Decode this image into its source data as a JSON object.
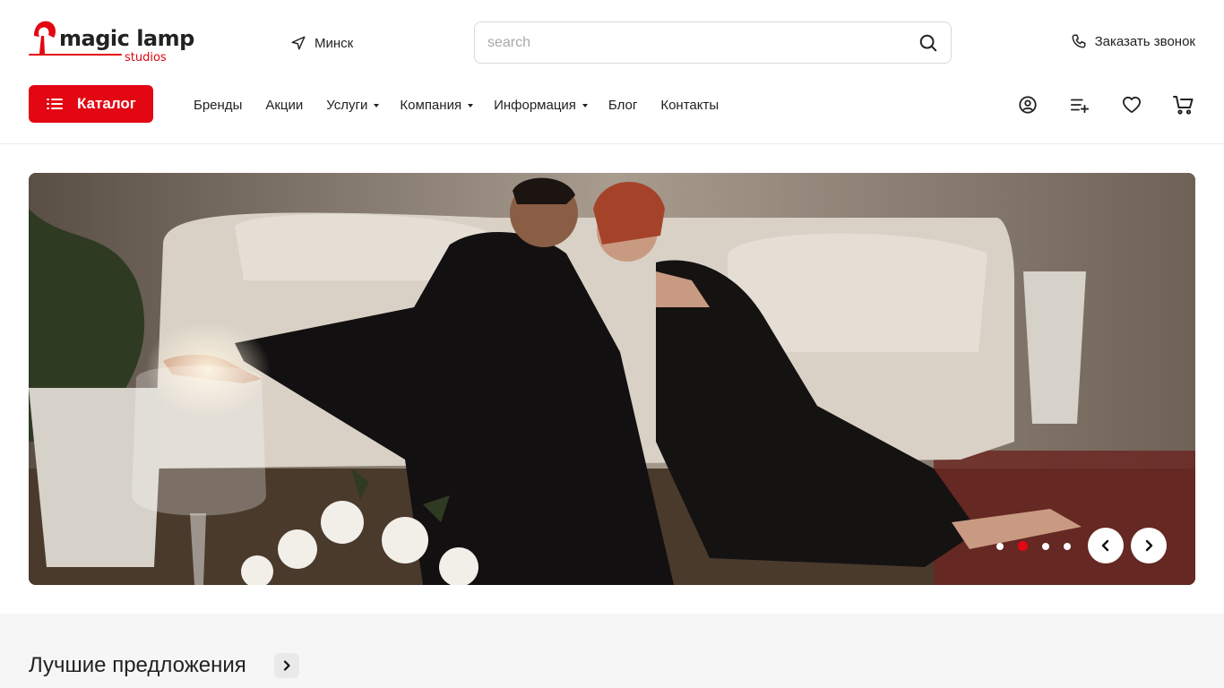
{
  "brand": {
    "name": "magic lamp",
    "sub": "studios",
    "color": "#e30613"
  },
  "header": {
    "city": "Минск",
    "city_icon": "location-arrow-icon",
    "search_placeholder": "search",
    "search_value": "",
    "callback_label": "Заказать звонок",
    "callback_icon": "phone-icon"
  },
  "catalog": {
    "label": "Каталог",
    "icon": "list-icon"
  },
  "nav": {
    "items": [
      {
        "label": "Бренды",
        "dropdown": false
      },
      {
        "label": "Акции",
        "dropdown": false
      },
      {
        "label": "Услуги",
        "dropdown": true
      },
      {
        "label": "Компания",
        "dropdown": true
      },
      {
        "label": "Информация",
        "dropdown": true
      },
      {
        "label": "Блог",
        "dropdown": false
      },
      {
        "label": "Контакты",
        "dropdown": false
      }
    ]
  },
  "user_icons": [
    "user-icon",
    "compare-list-icon",
    "heart-icon",
    "cart-icon"
  ],
  "slider": {
    "slide_count": 4,
    "active_index": 1,
    "image_description": "photo: couple sitting by a beige sofa with a glass lamp and white flowers"
  },
  "section": {
    "title": "Лучшие предложения"
  }
}
